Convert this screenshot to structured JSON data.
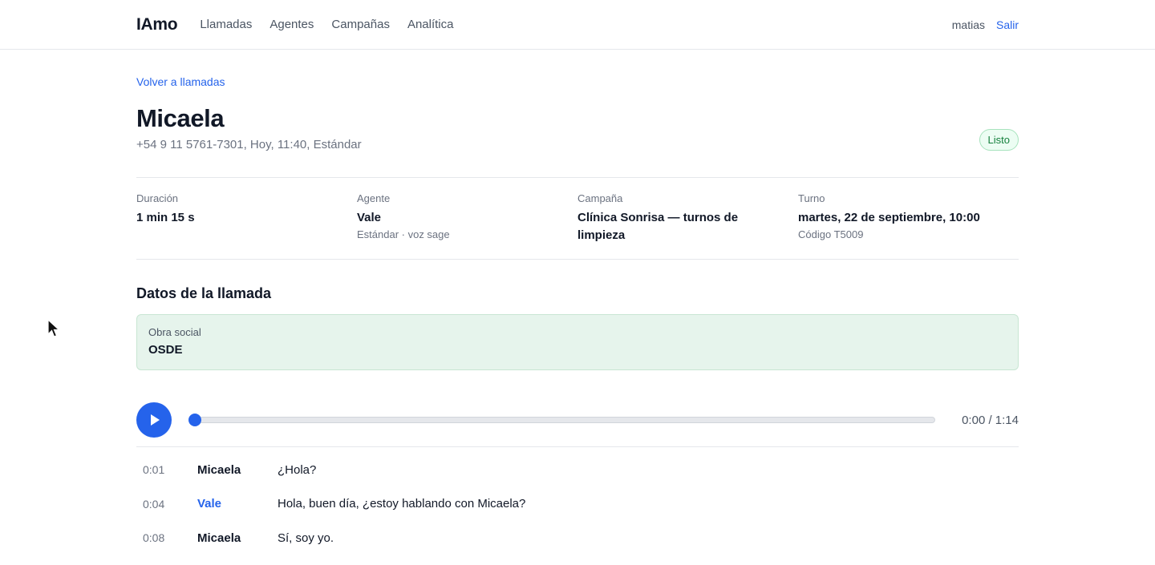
{
  "topbar": {
    "brand": "IAmo",
    "nav": [
      "Llamadas",
      "Agentes",
      "Campañas",
      "Analítica"
    ],
    "username": "matias",
    "logout": "Salir"
  },
  "back_link": "Volver a llamadas",
  "call": {
    "contact_name": "Micaela",
    "meta": "+54 9 11 5761-7301, Hoy, 11:40, Estándar",
    "status": "Listo"
  },
  "info": {
    "duration": {
      "label": "Duración",
      "value": "1 min 15 s"
    },
    "agent": {
      "label": "Agente",
      "value": "Vale",
      "sub": "Estándar · voz sage"
    },
    "campaign": {
      "label": "Campaña",
      "value": "Clínica Sonrisa — turnos de limpieza"
    },
    "appointment": {
      "label": "Turno",
      "value": "martes, 22 de septiembre, 10:00",
      "sub": "Código T5009"
    }
  },
  "call_data": {
    "title": "Datos de la llamada",
    "fields": [
      {
        "label": "Obra social",
        "value": "OSDE"
      }
    ]
  },
  "player": {
    "time": "0:00 / 1:14",
    "progress": 0
  },
  "transcript": [
    {
      "time": "0:01",
      "speaker": "Micaela",
      "role": "contact",
      "text": "¿Hola?"
    },
    {
      "time": "0:04",
      "speaker": "Vale",
      "role": "agent",
      "text": "Hola, buen día, ¿estoy hablando con Micaela?"
    },
    {
      "time": "0:08",
      "speaker": "Micaela",
      "role": "contact",
      "text": "Sí, soy yo."
    }
  ],
  "colors": {
    "accent": "#2563eb",
    "status_green": "#15803d",
    "field_bg": "#e6f4ec"
  },
  "icons": {
    "play": "play-icon",
    "cursor": "mouse-pointer-icon"
  }
}
